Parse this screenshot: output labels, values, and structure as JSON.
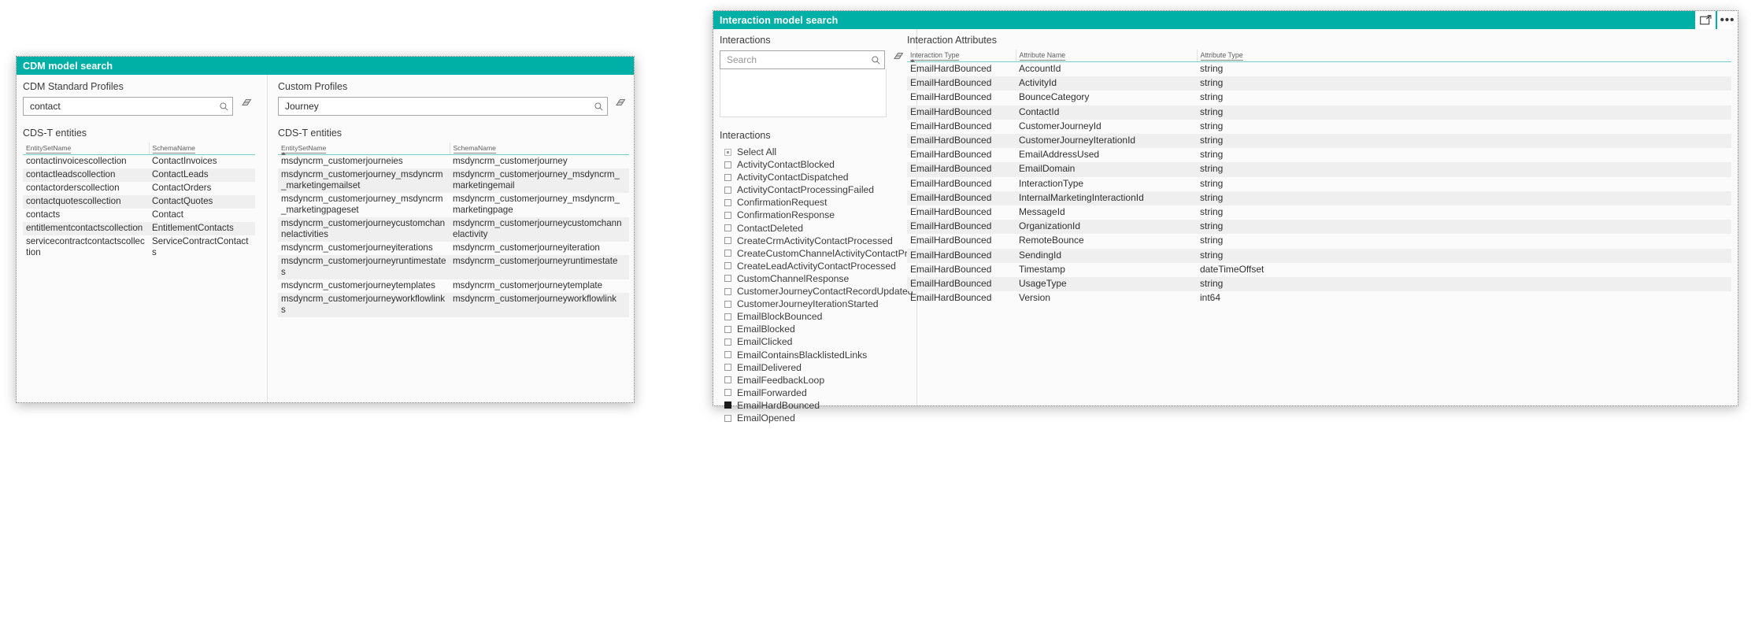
{
  "accent_color": "#00b0a6",
  "cdm_window": {
    "title": "CDM model search",
    "left": {
      "section_label": "CDM Standard Profiles",
      "search_value": "contact",
      "search_placeholder": "Search",
      "entities_label": "CDS-T entities",
      "columns": [
        "EntitySetName",
        "SchemaName"
      ],
      "rows": [
        [
          "contactinvoicescollection",
          "ContactInvoices"
        ],
        [
          "contactleadscollection",
          "ContactLeads"
        ],
        [
          "contactorderscollection",
          "ContactOrders"
        ],
        [
          "contactquotescollection",
          "ContactQuotes"
        ],
        [
          "contacts",
          "Contact"
        ],
        [
          "entitlementcontactscollection",
          "EntitlementContacts"
        ],
        [
          "servicecontractcontactscollection",
          "ServiceContractContacts"
        ]
      ]
    },
    "right": {
      "section_label": "Custom Profiles",
      "search_value": "Journey",
      "search_placeholder": "Search",
      "entities_label": "CDS-T entities",
      "columns": [
        "EntitySetName",
        "SchemaName"
      ],
      "rows": [
        [
          "msdyncrm_customerjourneies",
          "msdyncrm_customerjourney"
        ],
        [
          "msdyncrm_customerjourney_msdyncrm_marketingemailset",
          "msdyncrm_customerjourney_msdyncrm_marketingemail"
        ],
        [
          "msdyncrm_customerjourney_msdyncrm_marketingpageset",
          "msdyncrm_customerjourney_msdyncrm_marketingpage"
        ],
        [
          "msdyncrm_customerjourneycustomchannelactivities",
          "msdyncrm_customerjourneycustomchannelactivity"
        ],
        [
          "msdyncrm_customerjourneyiterations",
          "msdyncrm_customerjourneyiteration"
        ],
        [
          "msdyncrm_customerjourneyruntimestates",
          "msdyncrm_customerjourneyruntimestate"
        ],
        [
          "msdyncrm_customerjourneytemplates",
          "msdyncrm_customerjourneytemplate"
        ],
        [
          "msdyncrm_customerjourneyworkflowlinks",
          "msdyncrm_customerjourneyworkflowlink"
        ]
      ]
    }
  },
  "interaction_window": {
    "title": "Interaction model search",
    "titlebar_icons": [
      "popout-icon",
      "more-options-icon"
    ],
    "more_label": "•••",
    "left": {
      "section_label": "Interactions",
      "search_value": "",
      "search_placeholder": "Search",
      "list_label": "Interactions",
      "items": [
        {
          "label": "Select All",
          "state": "partial"
        },
        {
          "label": "ActivityContactBlocked",
          "state": "unchecked"
        },
        {
          "label": "ActivityContactDispatched",
          "state": "unchecked"
        },
        {
          "label": "ActivityContactProcessingFailed",
          "state": "unchecked"
        },
        {
          "label": "ConfirmationRequest",
          "state": "unchecked"
        },
        {
          "label": "ConfirmationResponse",
          "state": "unchecked"
        },
        {
          "label": "ContactDeleted",
          "state": "unchecked"
        },
        {
          "label": "CreateCrmActivityContactProcessed",
          "state": "unchecked"
        },
        {
          "label": "CreateCustomChannelActivityContactProc...",
          "state": "unchecked"
        },
        {
          "label": "CreateLeadActivityContactProcessed",
          "state": "unchecked"
        },
        {
          "label": "CustomChannelResponse",
          "state": "unchecked"
        },
        {
          "label": "CustomerJourneyContactRecordUpdated",
          "state": "unchecked"
        },
        {
          "label": "CustomerJourneyIterationStarted",
          "state": "unchecked"
        },
        {
          "label": "EmailBlockBounced",
          "state": "unchecked"
        },
        {
          "label": "EmailBlocked",
          "state": "unchecked"
        },
        {
          "label": "EmailClicked",
          "state": "unchecked"
        },
        {
          "label": "EmailContainsBlacklistedLinks",
          "state": "unchecked"
        },
        {
          "label": "EmailDelivered",
          "state": "unchecked"
        },
        {
          "label": "EmailFeedbackLoop",
          "state": "unchecked"
        },
        {
          "label": "EmailForwarded",
          "state": "unchecked"
        },
        {
          "label": "EmailHardBounced",
          "state": "checked"
        },
        {
          "label": "EmailOpened",
          "state": "unchecked"
        }
      ]
    },
    "right": {
      "section_label": "Interaction Attributes",
      "columns": [
        "Interaction Type",
        "Attribute Name",
        "Attribute Type"
      ],
      "rows": [
        [
          "EmailHardBounced",
          "AccountId",
          "string"
        ],
        [
          "EmailHardBounced",
          "ActivityId",
          "string"
        ],
        [
          "EmailHardBounced",
          "BounceCategory",
          "string"
        ],
        [
          "EmailHardBounced",
          "ContactId",
          "string"
        ],
        [
          "EmailHardBounced",
          "CustomerJourneyId",
          "string"
        ],
        [
          "EmailHardBounced",
          "CustomerJourneyIterationId",
          "string"
        ],
        [
          "EmailHardBounced",
          "EmailAddressUsed",
          "string"
        ],
        [
          "EmailHardBounced",
          "EmailDomain",
          "string"
        ],
        [
          "EmailHardBounced",
          "InteractionType",
          "string"
        ],
        [
          "EmailHardBounced",
          "InternalMarketingInteractionId",
          "string"
        ],
        [
          "EmailHardBounced",
          "MessageId",
          "string"
        ],
        [
          "EmailHardBounced",
          "OrganizationId",
          "string"
        ],
        [
          "EmailHardBounced",
          "RemoteBounce",
          "string"
        ],
        [
          "EmailHardBounced",
          "SendingId",
          "string"
        ],
        [
          "EmailHardBounced",
          "Timestamp",
          "dateTimeOffset"
        ],
        [
          "EmailHardBounced",
          "UsageType",
          "string"
        ],
        [
          "EmailHardBounced",
          "Version",
          "int64"
        ]
      ]
    }
  }
}
